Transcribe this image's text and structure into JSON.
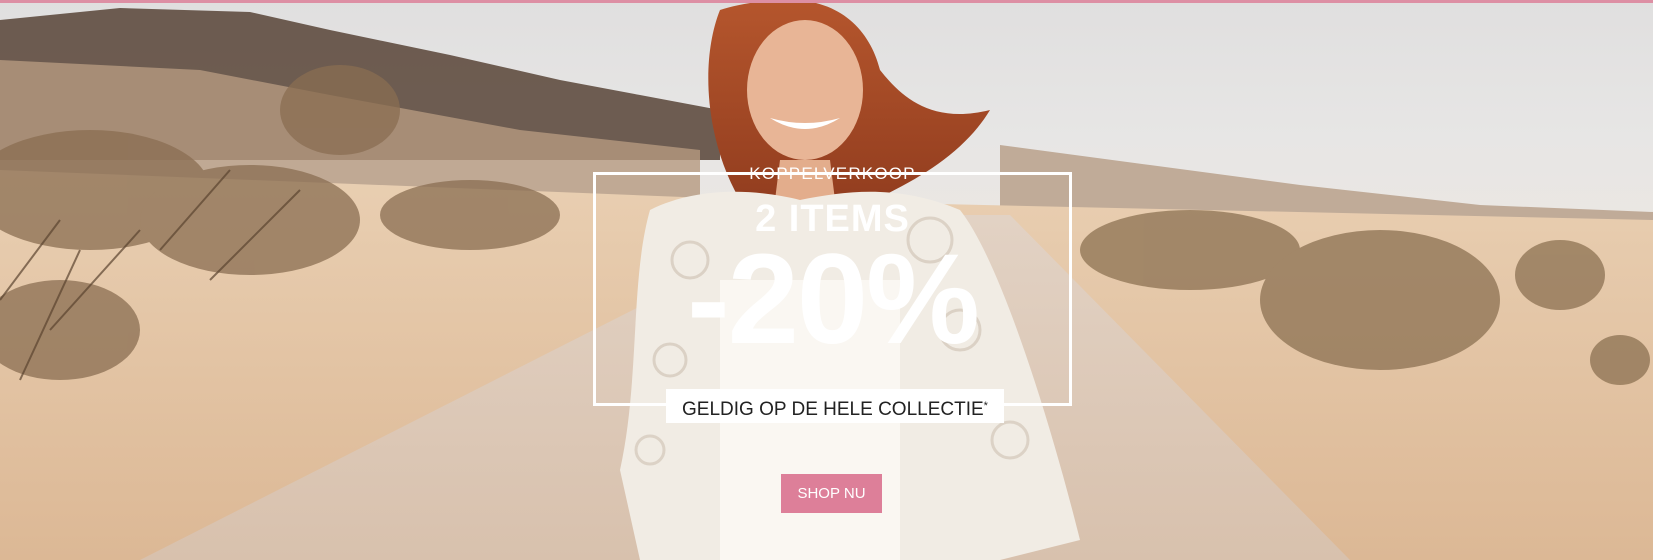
{
  "banner": {
    "kicker": "KOPPELVERKOOP",
    "headline": "2 ITEMS",
    "discount": "-20%",
    "label": "GELDIG OP DE HELE COLLECTIE",
    "label_mark": "*",
    "cta_label": "SHOP NU"
  },
  "colors": {
    "accent": "#dd8fa4",
    "button": "#dd7f99",
    "text_light": "#ffffff",
    "text_dark": "#222222"
  }
}
